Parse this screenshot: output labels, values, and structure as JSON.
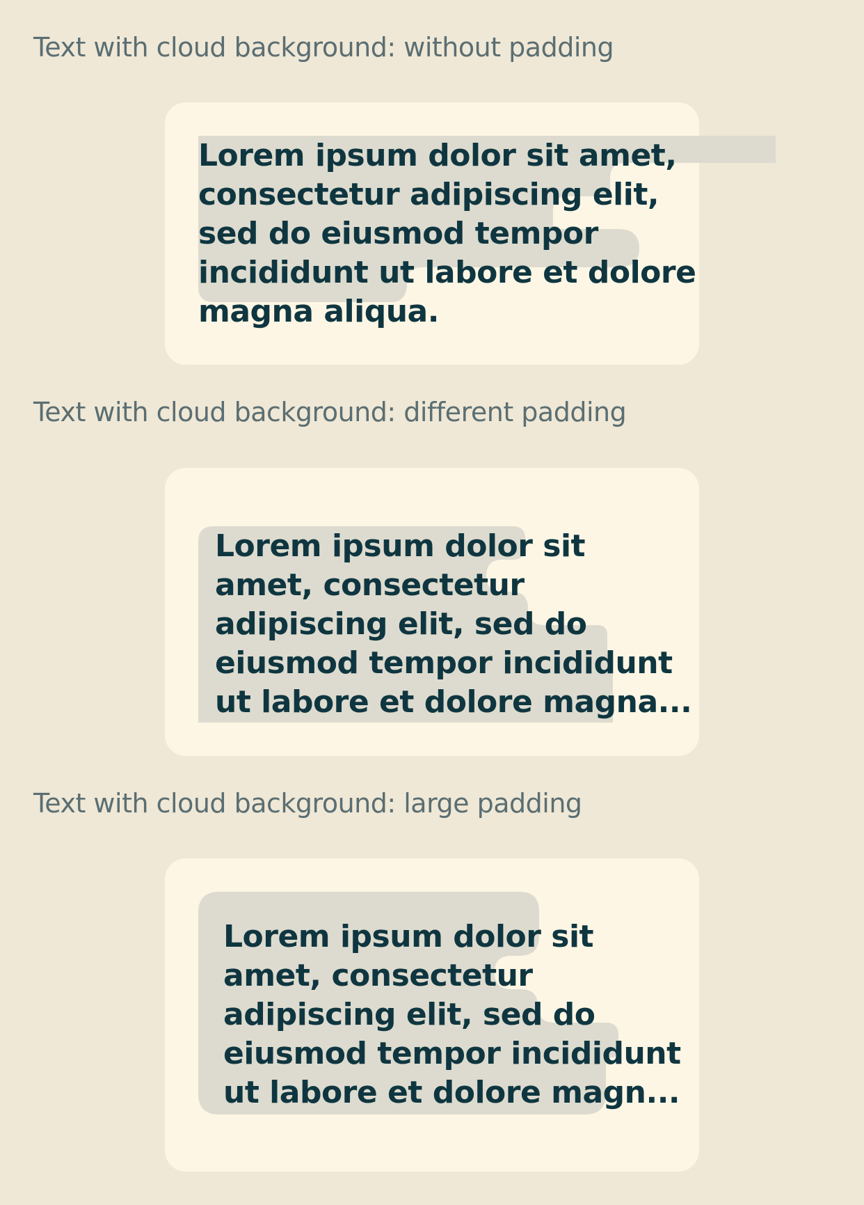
{
  "colors": {
    "page_background": "#efe8d6",
    "card_background": "#fdf6e5",
    "cloud_background": "#dddbcf",
    "title_text": "#5b6e72",
    "body_text": "#0f3640"
  },
  "sections": [
    {
      "title": "Text with cloud background: without padding",
      "lines": [
        "Lorem ipsum dolor sit amet,",
        "consectetur adipiscing elit,",
        "sed do eiusmod tempor",
        "incididunt ut labore et dolore",
        "magna aliqua."
      ]
    },
    {
      "title": "Text with cloud background: different padding",
      "lines": [
        "Lorem ipsum dolor sit",
        "amet, consectetur",
        "adipiscing elit, sed do",
        "eiusmod tempor incididunt",
        "ut labore et dolore magna..."
      ]
    },
    {
      "title": "Text with cloud background: large padding",
      "lines": [
        "Lorem ipsum dolor sit",
        "amet, consectetur",
        "adipiscing elit, sed do",
        "eiusmod tempor incididunt",
        "ut labore et dolore magn..."
      ]
    }
  ]
}
